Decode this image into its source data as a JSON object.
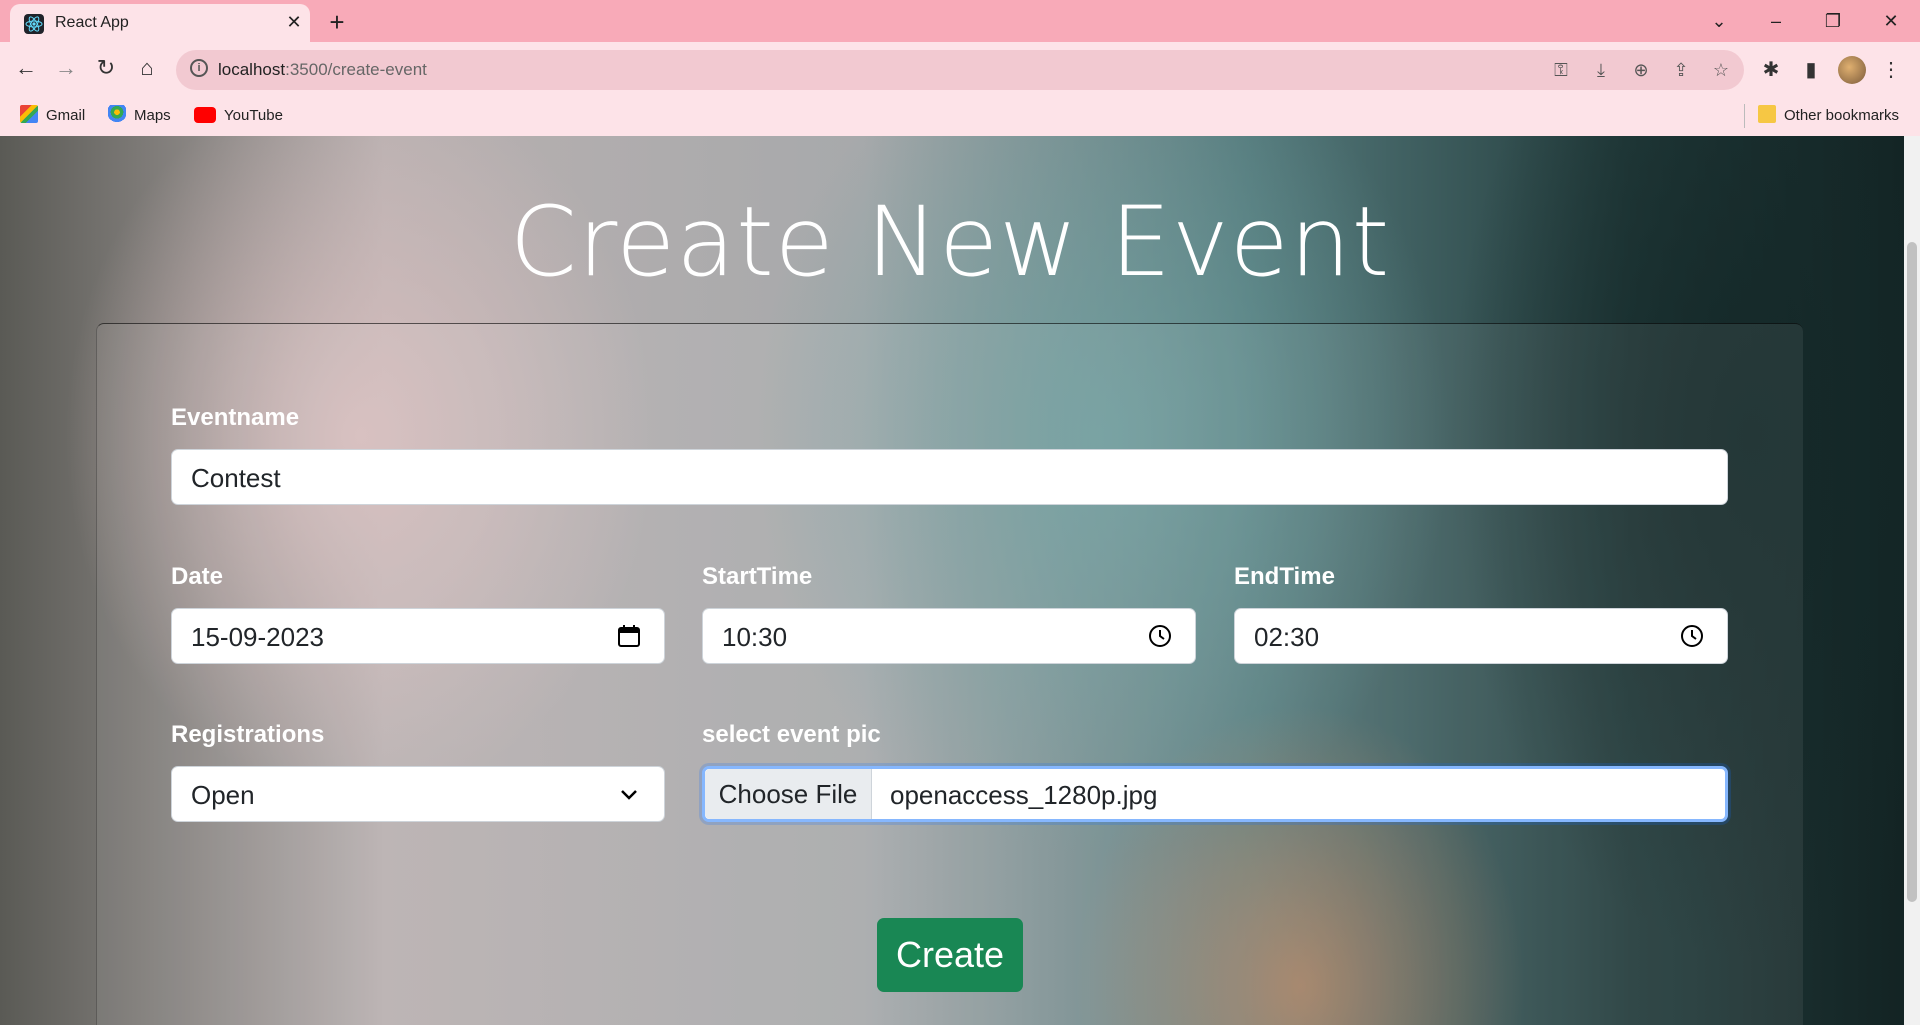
{
  "browser": {
    "tab_title": "React App",
    "url_host": "localhost",
    "url_path": ":3500/create-event",
    "bookmarks": [
      "Gmail",
      "Maps",
      "YouTube"
    ],
    "other_bookmarks": "Other bookmarks"
  },
  "page": {
    "title": "Create New Event",
    "eventname_label": "Eventname",
    "eventname_value": "Contest",
    "date_label": "Date",
    "date_value": "15-09-2023",
    "start_label": "StartTime",
    "start_value": "10:30",
    "end_label": "EndTime",
    "end_value": "02:30",
    "registrations_label": "Registrations",
    "registrations_value": "Open",
    "pic_label": "select event pic",
    "file_button": "Choose File",
    "file_name": "openaccess_1280p.jpg",
    "create_button": "Create"
  },
  "colors": {
    "chrome_tabbar": "#f8aab8",
    "chrome_toolbar": "#fde3e8",
    "create_button": "#198754",
    "focus_ring": "#86b7fe"
  }
}
